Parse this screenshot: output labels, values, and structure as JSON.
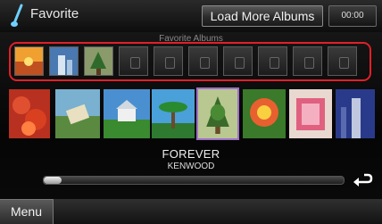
{
  "header": {
    "title": "Favorite",
    "load_more_label": "Load More Albums",
    "clock": "00:00"
  },
  "favorites": {
    "caption": "Favorite Albums",
    "slots": [
      "sunset-art",
      "building-art",
      "tree-art",
      "empty",
      "empty",
      "empty",
      "empty",
      "empty",
      "empty",
      "empty"
    ]
  },
  "now_playing": {
    "title": "FOREVER",
    "artist": "KENWOOD",
    "progress": 0.06
  },
  "footer": {
    "menu_label": "Menu"
  },
  "colors": {
    "highlight_frame": "#e0202a",
    "selection_border": "#a070c8"
  }
}
